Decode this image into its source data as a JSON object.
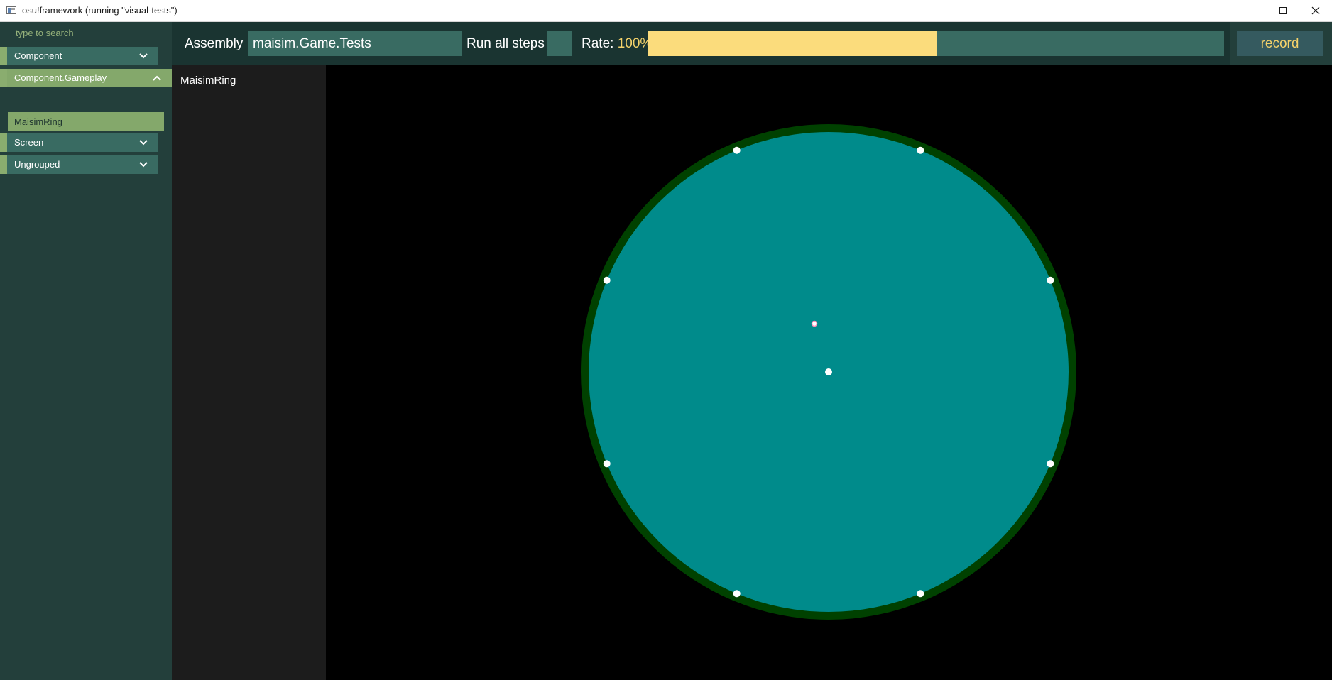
{
  "window": {
    "title": "osu!framework (running \"visual-tests\")",
    "controls": {
      "minimize": "minimize-icon",
      "maximize": "maximize-icon",
      "close": "close-icon"
    }
  },
  "sidebar": {
    "search_placeholder": "type to search",
    "groups": [
      {
        "label": "Component",
        "expanded": false,
        "icon": "chevron-down-icon"
      },
      {
        "label": "Component.Gameplay",
        "expanded": true,
        "icon": "chevron-up-icon",
        "tests": [
          "MaisimRing"
        ]
      },
      {
        "label": "Screen",
        "expanded": false,
        "icon": "chevron-down-icon"
      },
      {
        "label": "Ungrouped",
        "expanded": false,
        "icon": "chevron-down-icon"
      }
    ]
  },
  "toolbar": {
    "assembly_label": "Assembly",
    "assembly_value": "maisim.Game.Tests",
    "run_all_label": "Run all steps",
    "run_all_checked": false,
    "rate_label": "Rate:",
    "rate_value": "100%",
    "rate_slider_fill_fraction": 0.5,
    "record_label": "record"
  },
  "steps": {
    "test_name": "MaisimRing"
  },
  "scene": {
    "ring_fill_color": "#008b8b",
    "ring_border_color": "#004100",
    "sensor_color": "#ffffff",
    "cursor_color": "#ff8fb8"
  },
  "colors": {
    "sidebar_bg": "#233f3b",
    "item_bg": "#396b62",
    "selected_bg": "#84a86b",
    "accent_yellow": "#fbdc7c",
    "toolbar_bg": "#1a3431"
  }
}
